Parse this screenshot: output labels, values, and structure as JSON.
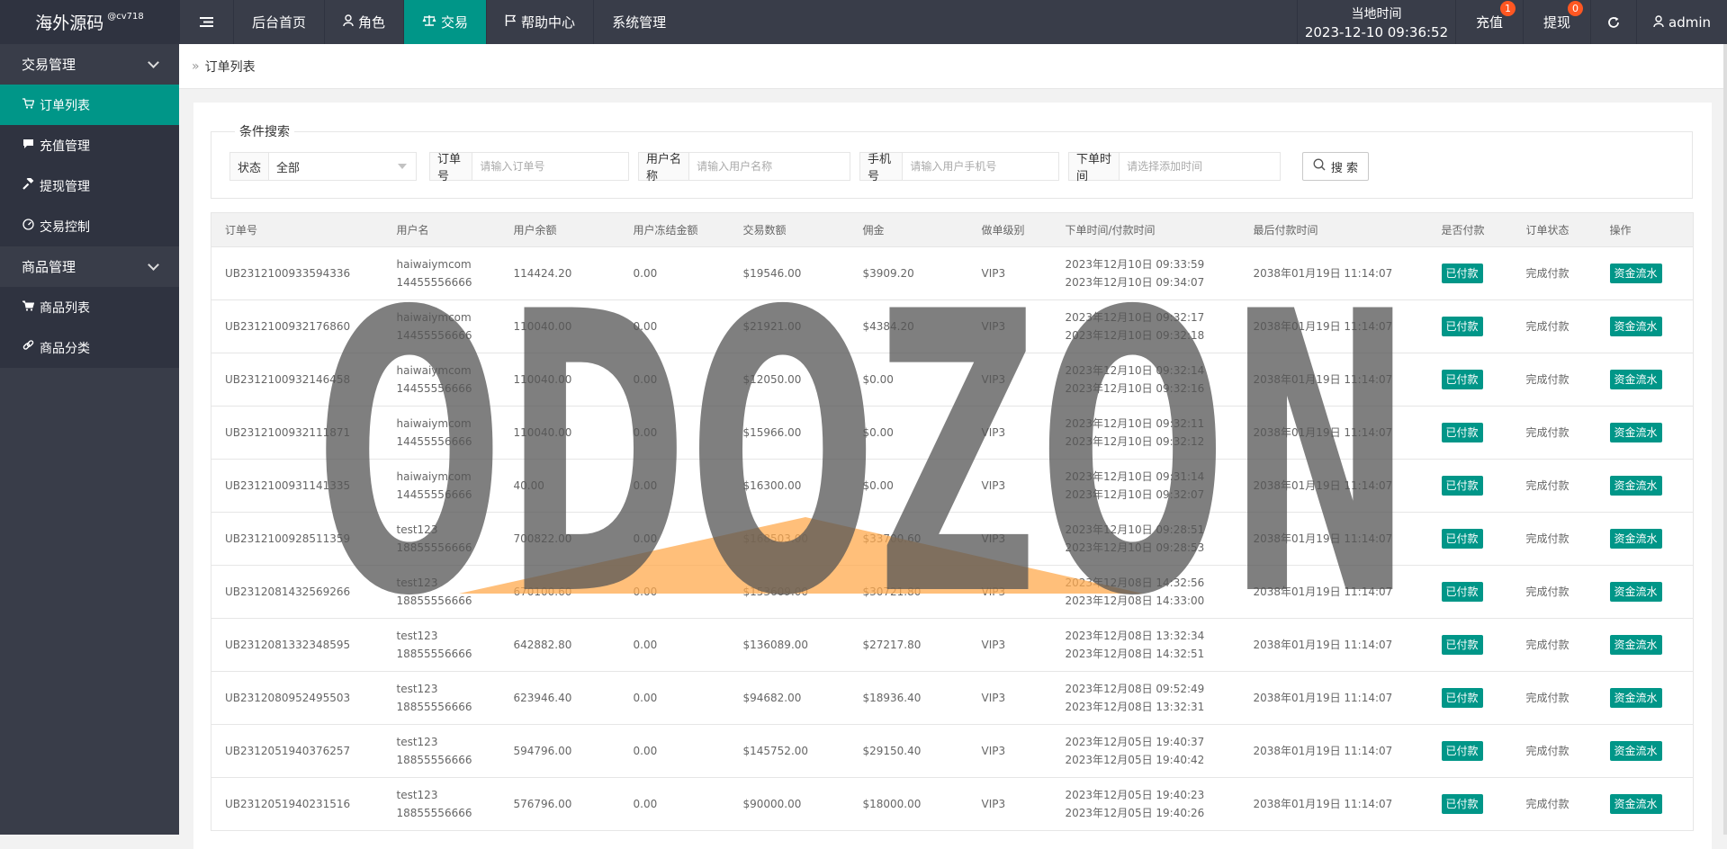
{
  "logo": {
    "title": "海外源码",
    "sup": "@cv718"
  },
  "nav": {
    "menu_icon": "hamburger-icon",
    "items": [
      {
        "label": "后台首页",
        "icon": ""
      },
      {
        "label": "角色",
        "icon": "user-icon"
      },
      {
        "label": "交易",
        "icon": "scale-icon",
        "active": true
      },
      {
        "label": "帮助中心",
        "icon": "flag-icon"
      },
      {
        "label": "系统管理",
        "icon": ""
      }
    ]
  },
  "header_right": {
    "time_label": "当地时间",
    "time_value": "2023-12-10 09:36:52",
    "recharge": "充值",
    "recharge_badge": "1",
    "withdraw": "提现",
    "withdraw_badge": "0",
    "refresh_icon": "refresh-icon",
    "user": "admin"
  },
  "sidebar": {
    "group1": "交易管理",
    "items1": [
      "订单列表",
      "充值管理",
      "提现管理",
      "交易控制"
    ],
    "group2": "商品管理",
    "items2": [
      "商品列表",
      "商品分类"
    ]
  },
  "breadcrumb": {
    "current": "订单列表"
  },
  "search": {
    "legend": "条件搜索",
    "status_label": "状态",
    "status_value": "全部",
    "order_label": "订单号",
    "order_placeholder": "请输入订单号",
    "username_label": "用户名称",
    "username_placeholder": "请输入用户名称",
    "phone_label": "手机号",
    "phone_placeholder": "请输入用户手机号",
    "time_label": "下单时间",
    "time_placeholder": "请选择添加时间",
    "button": "搜 索"
  },
  "table": {
    "headers": [
      "订单号",
      "用户名",
      "用户余额",
      "用户冻结金额",
      "交易数额",
      "佣金",
      "做单级别",
      "下单时间/付款时间",
      "最后付款时间",
      "是否付款",
      "订单状态",
      "操作"
    ],
    "rows": [
      {
        "order": "UB2312100933594336",
        "user": "haiwaiymcom",
        "phone": "14455556666",
        "balance": "114424.20",
        "frozen": "0.00",
        "amount": "$19546.00",
        "commission": "$3909.20",
        "level": "VIP3",
        "t1": "2023年12月10日 09:33:59",
        "t2": "2023年12月10日 09:34:07",
        "last": "2038年01月19日 11:14:07",
        "paid": "已付款",
        "status": "完成付款",
        "action": "资金流水"
      },
      {
        "order": "UB2312100932176860",
        "user": "haiwaiymcom",
        "phone": "14455556666",
        "balance": "110040.00",
        "frozen": "0.00",
        "amount": "$21921.00",
        "commission": "$4384.20",
        "level": "VIP3",
        "t1": "2023年12月10日 09:32:17",
        "t2": "2023年12月10日 09:32:18",
        "last": "2038年01月19日 11:14:07",
        "paid": "已付款",
        "status": "完成付款",
        "action": "资金流水"
      },
      {
        "order": "UB2312100932146458",
        "user": "haiwaiymcom",
        "phone": "14455556666",
        "balance": "110040.00",
        "frozen": "0.00",
        "amount": "$12050.00",
        "commission": "$0.00",
        "level": "VIP3",
        "t1": "2023年12月10日 09:32:14",
        "t2": "2023年12月10日 09:32:16",
        "last": "2038年01月19日 11:14:07",
        "paid": "已付款",
        "status": "完成付款",
        "action": "资金流水"
      },
      {
        "order": "UB2312100932111871",
        "user": "haiwaiymcom",
        "phone": "14455556666",
        "balance": "110040.00",
        "frozen": "0.00",
        "amount": "$15966.00",
        "commission": "$0.00",
        "level": "VIP3",
        "t1": "2023年12月10日 09:32:11",
        "t2": "2023年12月10日 09:32:12",
        "last": "2038年01月19日 11:14:07",
        "paid": "已付款",
        "status": "完成付款",
        "action": "资金流水"
      },
      {
        "order": "UB2312100931141335",
        "user": "haiwaiymcom",
        "phone": "14455556666",
        "balance": "40.00",
        "frozen": "0.00",
        "amount": "$16300.00",
        "commission": "$0.00",
        "level": "VIP3",
        "t1": "2023年12月10日 09:31:14",
        "t2": "2023年12月10日 09:32:07",
        "last": "2038年01月19日 11:14:07",
        "paid": "已付款",
        "status": "完成付款",
        "action": "资金流水"
      },
      {
        "order": "UB2312100928511359",
        "user": "test123",
        "phone": "18855556666",
        "balance": "700822.00",
        "frozen": "0.00",
        "amount": "$168503.00",
        "commission": "$33700.60",
        "level": "VIP3",
        "t1": "2023年12月10日 09:28:51",
        "t2": "2023年12月10日 09:28:53",
        "last": "2038年01月19日 11:14:07",
        "paid": "已付款",
        "status": "完成付款",
        "action": "资金流水"
      },
      {
        "order": "UB2312081432569266",
        "user": "test123",
        "phone": "18855556666",
        "balance": "670100.60",
        "frozen": "0.00",
        "amount": "$153609.00",
        "commission": "$30721.80",
        "level": "VIP3",
        "t1": "2023年12月08日 14:32:56",
        "t2": "2023年12月08日 14:33:00",
        "last": "2038年01月19日 11:14:07",
        "paid": "已付款",
        "status": "完成付款",
        "action": "资金流水"
      },
      {
        "order": "UB2312081332348595",
        "user": "test123",
        "phone": "18855556666",
        "balance": "642882.80",
        "frozen": "0.00",
        "amount": "$136089.00",
        "commission": "$27217.80",
        "level": "VIP3",
        "t1": "2023年12月08日 13:32:34",
        "t2": "2023年12月08日 14:32:51",
        "last": "2038年01月19日 11:14:07",
        "paid": "已付款",
        "status": "完成付款",
        "action": "资金流水"
      },
      {
        "order": "UB2312080952495503",
        "user": "test123",
        "phone": "18855556666",
        "balance": "623946.40",
        "frozen": "0.00",
        "amount": "$94682.00",
        "commission": "$18936.40",
        "level": "VIP3",
        "t1": "2023年12月08日 09:52:49",
        "t2": "2023年12月08日 13:32:31",
        "last": "2038年01月19日 11:14:07",
        "paid": "已付款",
        "status": "完成付款",
        "action": "资金流水"
      },
      {
        "order": "UB2312051940376257",
        "user": "test123",
        "phone": "18855556666",
        "balance": "594796.00",
        "frozen": "0.00",
        "amount": "$145752.00",
        "commission": "$29150.40",
        "level": "VIP3",
        "t1": "2023年12月05日 19:40:37",
        "t2": "2023年12月05日 19:40:42",
        "last": "2038年01月19日 11:14:07",
        "paid": "已付款",
        "status": "完成付款",
        "action": "资金流水"
      },
      {
        "order": "UB2312051940231516",
        "user": "test123",
        "phone": "18855556666",
        "balance": "576796.00",
        "frozen": "0.00",
        "amount": "$90000.00",
        "commission": "$18000.00",
        "level": "VIP3",
        "t1": "2023年12月05日 19:40:23",
        "t2": "2023年12月05日 19:40:26",
        "last": "2038年01月19日 11:14:07",
        "paid": "已付款",
        "status": "完成付款",
        "action": "资金流水"
      }
    ]
  },
  "watermark": {
    "text": "ODOZON",
    "color": "#555555",
    "accent": "#ffa94d"
  }
}
